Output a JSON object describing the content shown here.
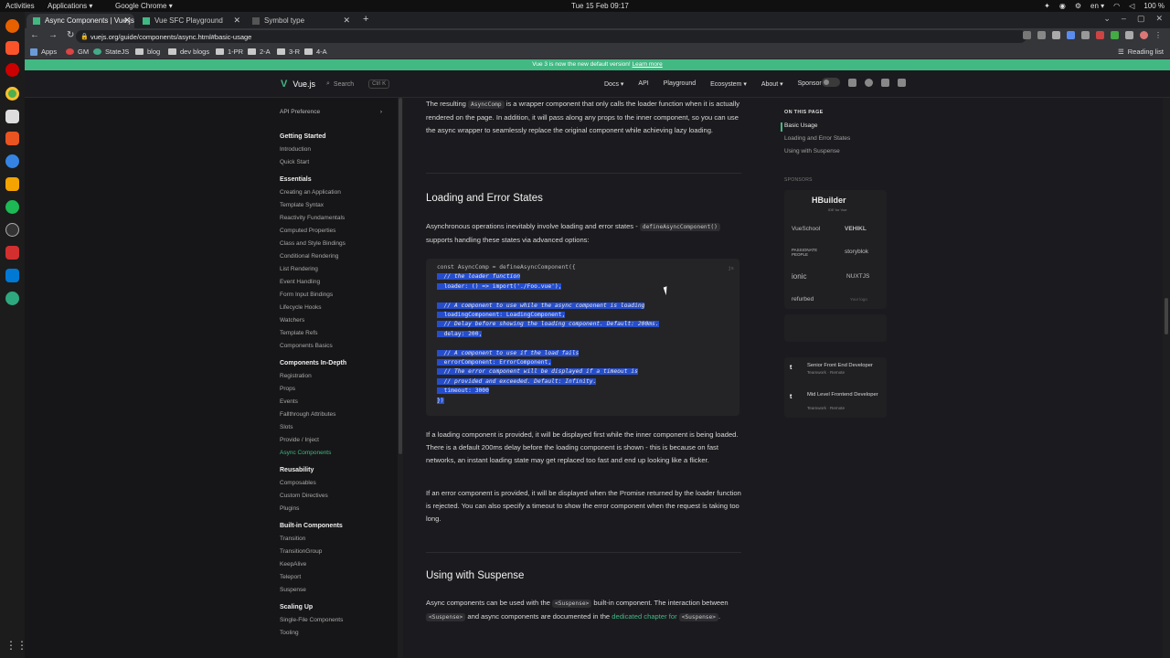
{
  "os": {
    "activities": "Activities",
    "applications": "Applications ▾",
    "chrome_label": "Google Chrome ▾",
    "clock": "Tue 15 Feb  09:17",
    "lang": "en ▾",
    "battery": "100 %"
  },
  "browser": {
    "tabs": [
      {
        "label": "Async Components | Vue.js"
      },
      {
        "label": "Vue SFC Playground"
      },
      {
        "label": "Symbol type"
      }
    ],
    "new_tab": "+",
    "url": "vuejs.org/guide/components/async.html#basic-usage",
    "bookmarks": {
      "apps": "Apps",
      "gm": "GM",
      "statejs": "StateJS",
      "items": [
        "blog",
        "dev blogs",
        "1-PR",
        "2-A",
        "3-R",
        "4-A"
      ],
      "reading_list": "Reading list"
    }
  },
  "banner": {
    "text": "Vue 3 is now the new default version!",
    "link": "Learn more"
  },
  "nav": {
    "logo": "Vue.js",
    "search": "Search",
    "search_kbd": "Ctrl K",
    "links": [
      "Docs ▾",
      "API",
      "Playground",
      "Ecosystem ▾",
      "About ▾",
      "Sponsor"
    ]
  },
  "sidebar": {
    "api_preference": "API Preference",
    "sections": [
      {
        "title": "Getting Started",
        "items": [
          "Introduction",
          "Quick Start"
        ]
      },
      {
        "title": "Essentials",
        "items": [
          "Creating an Application",
          "Template Syntax",
          "Reactivity Fundamentals",
          "Computed Properties",
          "Class and Style Bindings",
          "Conditional Rendering",
          "List Rendering",
          "Event Handling",
          "Form Input Bindings",
          "Lifecycle Hooks",
          "Watchers",
          "Template Refs",
          "Components Basics"
        ]
      },
      {
        "title": "Components In-Depth",
        "items": [
          "Registration",
          "Props",
          "Events",
          "Fallthrough Attributes",
          "Slots",
          "Provide / Inject",
          "Async Components"
        ]
      },
      {
        "title": "Reusability",
        "items": [
          "Composables",
          "Custom Directives",
          "Plugins"
        ]
      },
      {
        "title": "Built-in Components",
        "items": [
          "Transition",
          "TransitionGroup",
          "KeepAlive",
          "Teleport",
          "Suspense"
        ]
      },
      {
        "title": "Scaling Up",
        "items": [
          "Single-File Components",
          "Tooling"
        ]
      }
    ],
    "active_item": "Async Components"
  },
  "content": {
    "p1_a": "The resulting ",
    "p1_code": "AsyncComp",
    "p1_b": " is a wrapper component that only calls the loader function when it is actually rendered on the page. In addition, it will pass along any props to the inner component, so you can use the async wrapper to seamlessly replace the original component while achieving lazy loading.",
    "h2_loading": "Loading and Error States",
    "p2_a": "Asynchronous operations inevitably involve loading and error states - ",
    "p2_code": "defineAsyncComponent()",
    "p2_b": " supports handling these states via advanced options:",
    "code_lang": "js",
    "code_lines": [
      "const AsyncComp = defineAsyncComponent({",
      "  // the loader function",
      "  loader: () => import('./Foo.vue'),",
      "",
      "  // A component to use while the async component is loading",
      "  loadingComponent: LoadingComponent,",
      "  // Delay before showing the loading component. Default: 200ms.",
      "  delay: 200,",
      "",
      "  // A component to use if the load fails",
      "  errorComponent: ErrorComponent,",
      "  // The error component will be displayed if a timeout is",
      "  // provided and exceeded. Default: Infinity.",
      "  timeout: 3000",
      "})"
    ],
    "p3": "If a loading component is provided, it will be displayed first while the inner component is being loaded. There is a default 200ms delay before the loading component is shown - this is because on fast networks, an instant loading state may get replaced too fast and end up looking like a flicker.",
    "p4": "If an error component is provided, it will be displayed when the Promise returned by the loader function is rejected. You can also specify a timeout to show the error component when the request is taking too long.",
    "h2_suspense": "Using with Suspense",
    "p5_a": "Async components can be used with the ",
    "p5_code1": "<Suspense>",
    "p5_b": " built-in component. The interaction between ",
    "p5_code2": "<Suspense>",
    "p5_c": " and async components are documented in the ",
    "p5_link": "dedicated chapter for ",
    "p5_code3": "<Suspense>",
    "p5_d": "."
  },
  "aside": {
    "on_this_page": "ON THIS PAGE",
    "items": [
      "Basic Usage",
      "Loading and Error States",
      "Using with Suspense"
    ],
    "sponsors_title": "SPONSORS",
    "sponsors": {
      "hbuilder": "HBuilder",
      "hbuilder_sub": "IDE for Vue",
      "vueschool": "VueSchool",
      "vehikl": "VEHIKL",
      "passionate": "PASSIONATE PEOPLE",
      "storyblok": "storyblok",
      "ionic": "ionic",
      "nuxtjs": "NUXTJS",
      "refurbed": "refurbed",
      "yourlogo": "Your logo"
    },
    "jobs": [
      {
        "title": "Senior Front End Developer",
        "sub": "Teamwork · Remote"
      },
      {
        "title": "Mid Level Frontend Developer",
        "sub": "Teamwork · Remote"
      }
    ]
  }
}
